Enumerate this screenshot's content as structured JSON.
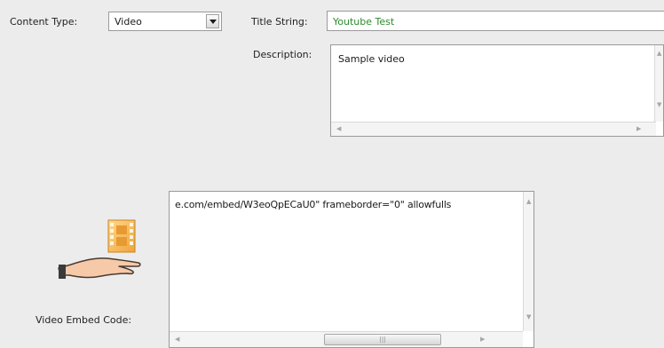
{
  "content_type": {
    "label": "Content Type:",
    "selected": "Video"
  },
  "title_string": {
    "label": "Title String:",
    "value": "Youtube Test",
    "value_color": "#2e8b2e"
  },
  "description": {
    "label": "Description:",
    "value": "Sample video"
  },
  "embed_code": {
    "label": "Video Embed Code:",
    "value": "e.com/embed/W3eoQpECaU0\" frameborder=\"0\" allowfulls"
  },
  "icons": {
    "dropdown": "chevron-down-icon",
    "embed_illustration": "hand-holding-film-icon"
  }
}
